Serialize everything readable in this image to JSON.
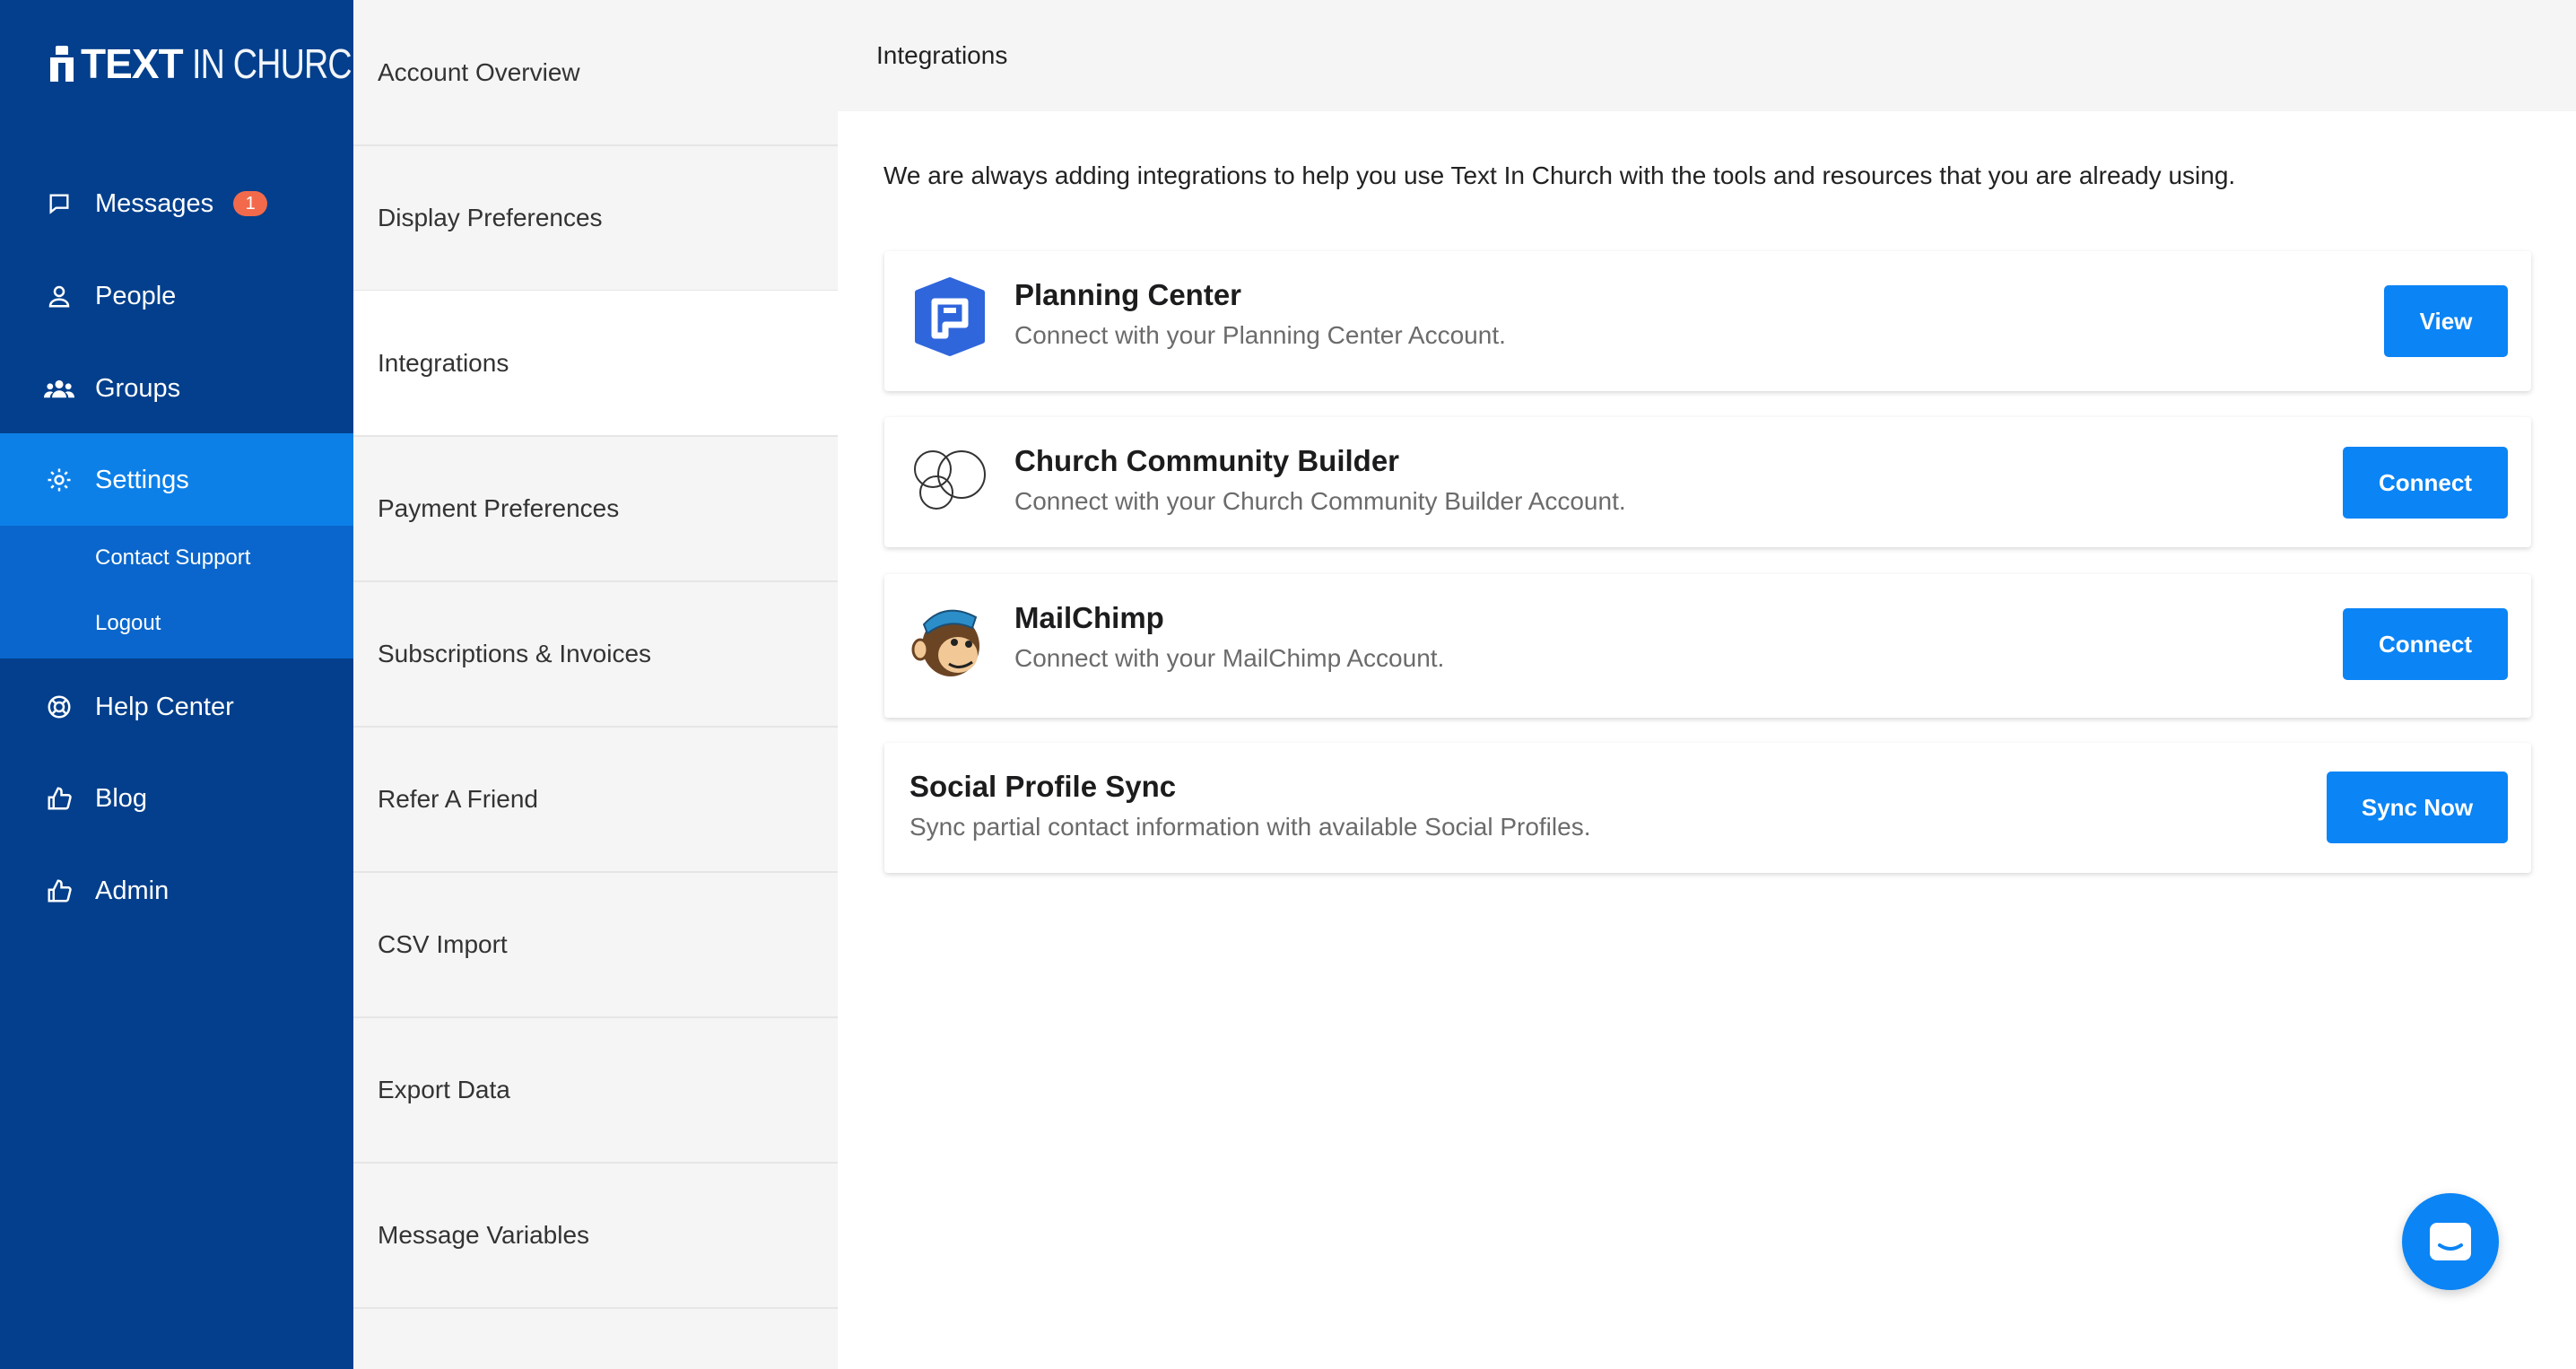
{
  "brand": {
    "logo_bold": "TEXT",
    "logo_thin": "IN CHURCH"
  },
  "nav": {
    "messages": {
      "label": "Messages",
      "badge": "1",
      "icon": "chat-bubble-icon"
    },
    "people": {
      "label": "People",
      "icon": "person-icon"
    },
    "groups": {
      "label": "Groups",
      "icon": "group-icon"
    },
    "settings": {
      "label": "Settings",
      "icon": "gear-icon"
    },
    "contact_support": "Contact Support",
    "logout": "Logout",
    "help_center": {
      "label": "Help Center",
      "icon": "lifebuoy-icon"
    },
    "blog": {
      "label": "Blog",
      "icon": "thumbs-up-icon"
    },
    "admin": {
      "label": "Admin",
      "icon": "thumbs-up-icon"
    }
  },
  "settings_menu": [
    {
      "label": "Account Overview"
    },
    {
      "label": "Display Preferences"
    },
    {
      "label": "Integrations",
      "active": true
    },
    {
      "label": "Payment Preferences"
    },
    {
      "label": "Subscriptions & Invoices"
    },
    {
      "label": "Refer A Friend"
    },
    {
      "label": "CSV Import"
    },
    {
      "label": "Export Data"
    },
    {
      "label": "Message Variables"
    }
  ],
  "page": {
    "title": "Integrations",
    "intro": "We are always adding integrations to help you use Text In Church with the tools and resources that you are already using."
  },
  "integrations": [
    {
      "name": "Planning Center",
      "description": "Connect with your Planning Center Account.",
      "button": "View",
      "icon": "planning-center-logo"
    },
    {
      "name": "Church Community Builder",
      "description": "Connect with your Church Community Builder Account.",
      "button": "Connect",
      "icon": "ccb-logo"
    },
    {
      "name": "MailChimp",
      "description": "Connect with your MailChimp Account.",
      "button": "Connect",
      "icon": "mailchimp-logo"
    },
    {
      "name": "Social Profile Sync",
      "description": "Sync partial contact information with available Social Profiles.",
      "button": "Sync Now"
    }
  ],
  "colors": {
    "nav_bg": "#033f8c",
    "nav_active": "#0d80e8",
    "subnav_bg": "#0a66cc",
    "accent": "#0b84f5",
    "badge": "#f26a4b"
  }
}
